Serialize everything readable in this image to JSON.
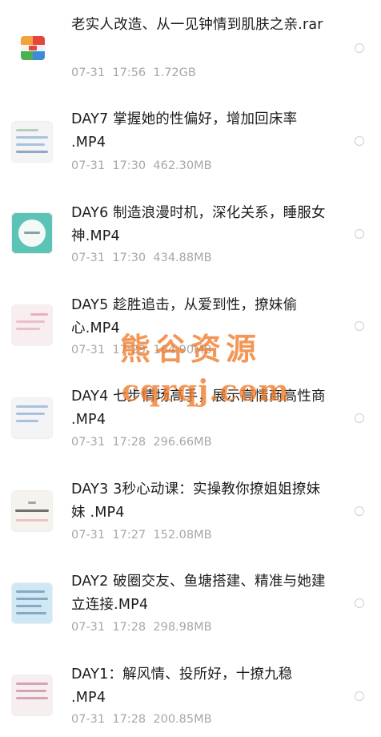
{
  "files": [
    {
      "name": "老实人改造、从一见钟情到肌肤之亲.rar",
      "date": "07-31",
      "time": "17:56",
      "size": "1.72GB",
      "thumb": "rar-archive-icon"
    },
    {
      "name": "DAY7 掌握她的性偏好，增加回床率 .MP4",
      "date": "07-31",
      "time": "17:30",
      "size": "462.30MB",
      "thumb": "video-thumbnail"
    },
    {
      "name": "DAY6 制造浪漫时机，深化关系，睡服女神.MP4",
      "date": "07-31",
      "time": "17:30",
      "size": "434.88MB",
      "thumb": "video-thumbnail"
    },
    {
      "name": "DAY5 趁胜追击，从爱到性，撩妹偷心.MP4",
      "date": "07-31",
      "time": "17:29",
      "size": "164.90MB",
      "thumb": "video-thumbnail"
    },
    {
      "name": "DAY4 七步情场高手，展示高情商高性商 .MP4",
      "date": "07-31",
      "time": "17:28",
      "size": "296.66MB",
      "thumb": "video-thumbnail"
    },
    {
      "name": "DAY3 3秒心动课：实操教你撩姐姐撩妹妹 .MP4",
      "date": "07-31",
      "time": "17:27",
      "size": "152.08MB",
      "thumb": "video-thumbnail"
    },
    {
      "name": "DAY2 破圈交友、鱼塘搭建、精准与她建立连接.MP4",
      "date": "07-31",
      "time": "17:28",
      "size": "298.98MB",
      "thumb": "video-thumbnail"
    },
    {
      "name": "DAY1：解风情、投所好，十撩九稳 .MP4",
      "date": "07-31",
      "time": "17:28",
      "size": "200.85MB",
      "thumb": "video-thumbnail"
    }
  ],
  "watermark": {
    "cn": "熊谷资源",
    "en": "cqrqj.com"
  },
  "colors": {
    "text": "#1c1c1c",
    "meta": "#a7a7a7",
    "watermark": "#f07a2a"
  }
}
